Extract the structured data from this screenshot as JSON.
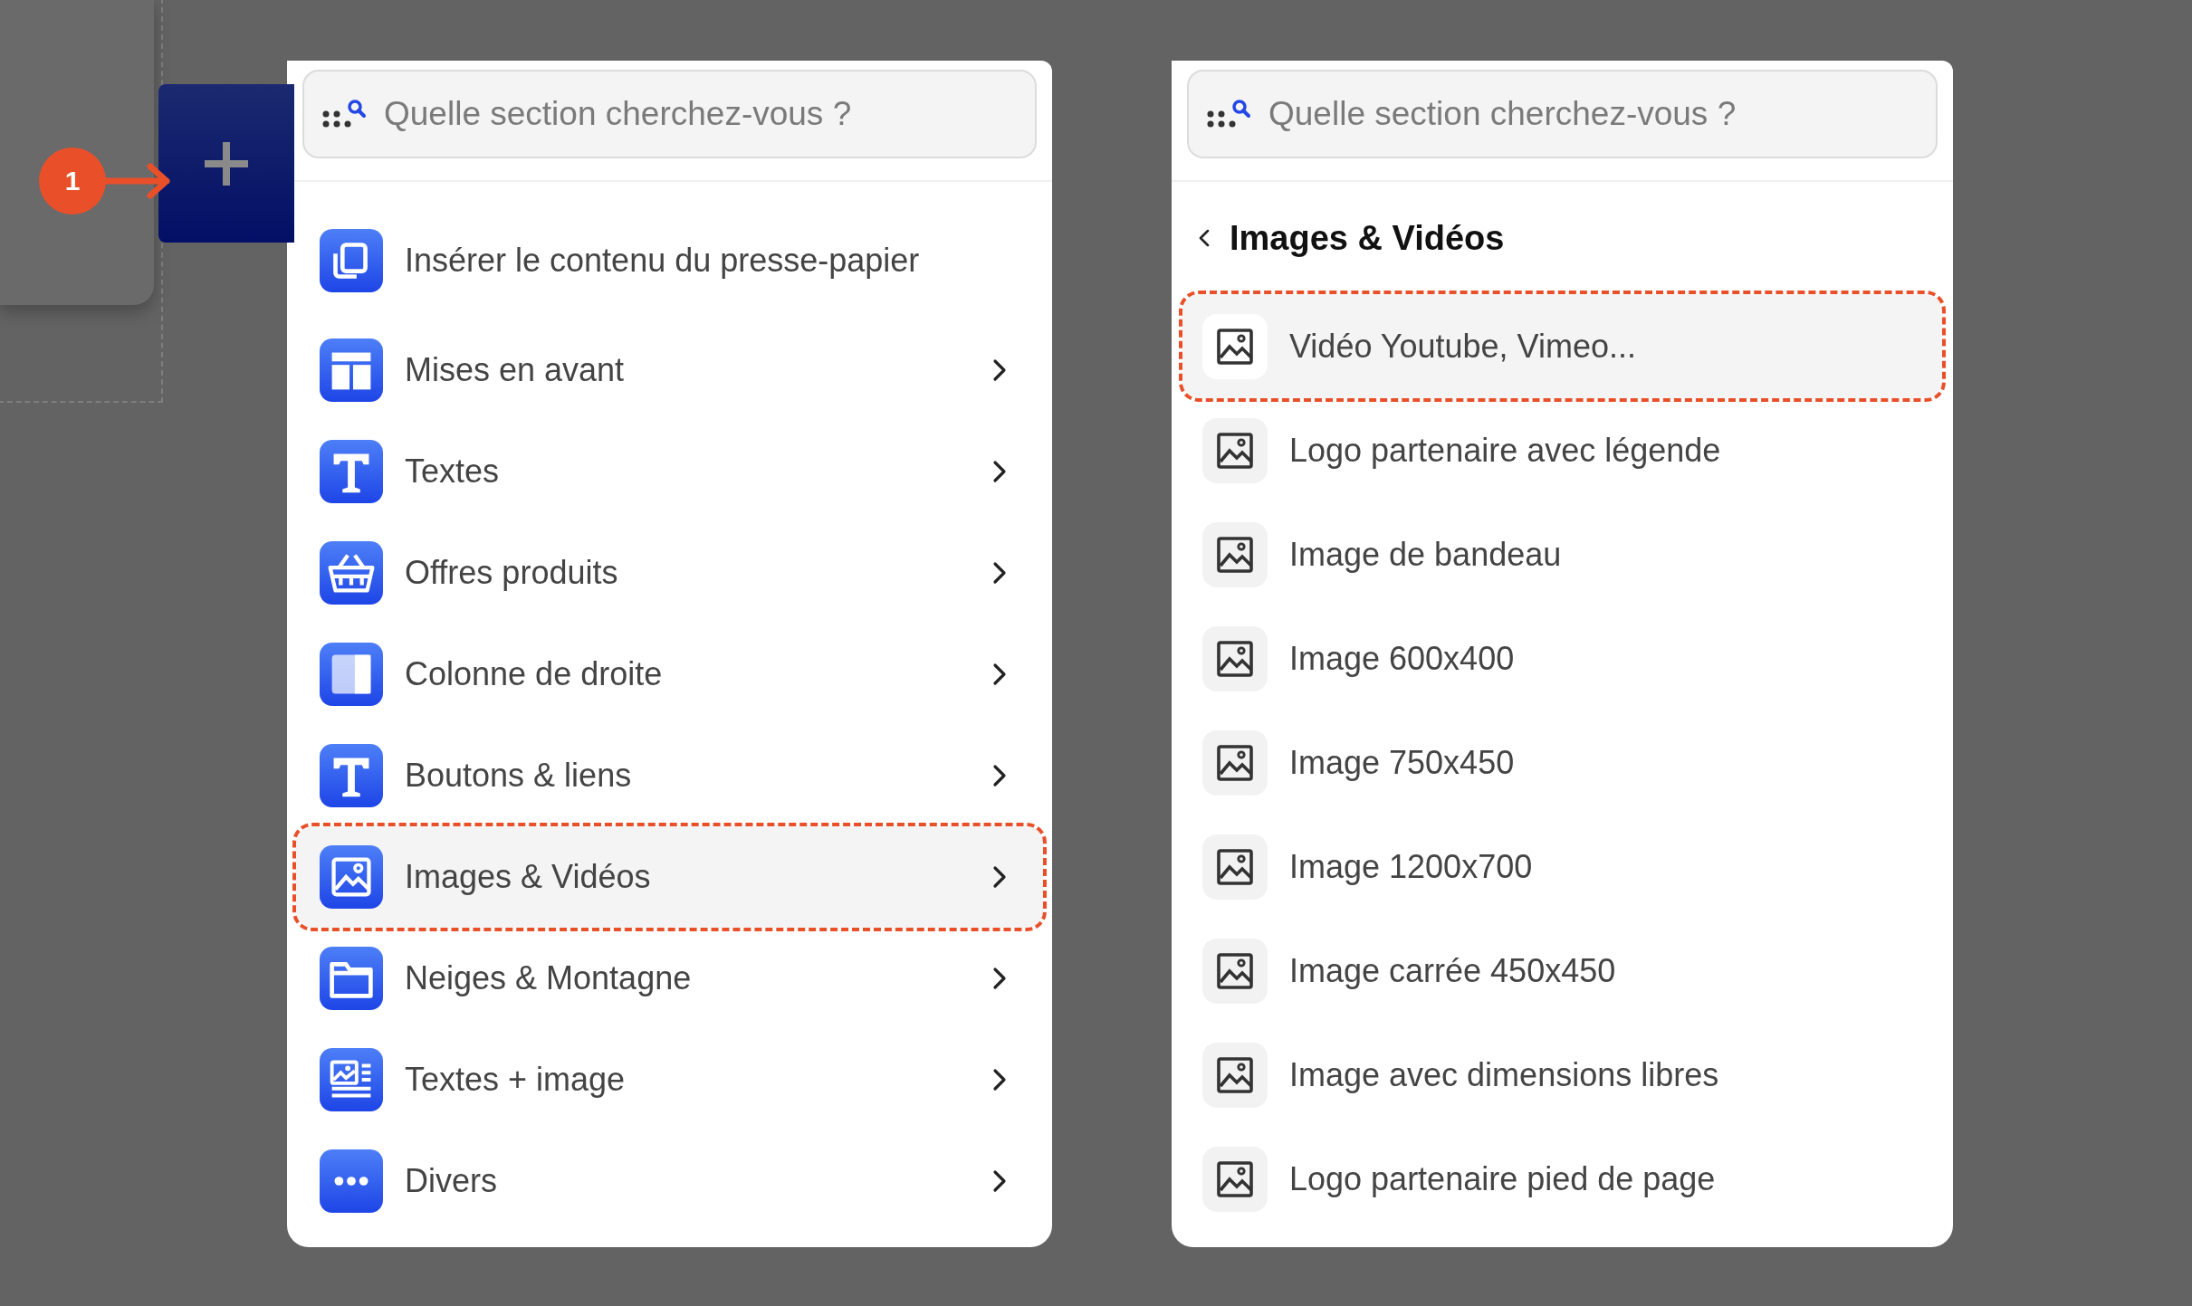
{
  "annotation": {
    "badge": "1"
  },
  "left_panel": {
    "search": {
      "placeholder": "Quelle section cherchez-vous ?"
    },
    "items": [
      {
        "label": "Insérer le contenu du presse-papier",
        "kind": "action",
        "selected": false
      },
      {
        "label": "Mises en avant",
        "kind": "submenu",
        "selected": false
      },
      {
        "label": "Textes",
        "kind": "submenu",
        "selected": false
      },
      {
        "label": "Offres produits",
        "kind": "submenu",
        "selected": false
      },
      {
        "label": "Colonne de droite",
        "kind": "submenu",
        "selected": false
      },
      {
        "label": "Boutons & liens",
        "kind": "submenu",
        "selected": false
      },
      {
        "label": "Images & Vidéos",
        "kind": "submenu",
        "selected": true
      },
      {
        "label": "Neiges & Montagne",
        "kind": "submenu",
        "selected": false
      },
      {
        "label": "Textes + image",
        "kind": "submenu",
        "selected": false
      },
      {
        "label": "Divers",
        "kind": "submenu",
        "selected": false
      }
    ]
  },
  "right_panel": {
    "search": {
      "placeholder": "Quelle section cherchez-vous ?"
    },
    "title": "Images & Vidéos",
    "items": [
      {
        "label": "Vidéo Youtube, Vimeo...",
        "selected": true
      },
      {
        "label": "Logo partenaire avec légende",
        "selected": false
      },
      {
        "label": "Image de bandeau",
        "selected": false
      },
      {
        "label": "Image 600x400",
        "selected": false
      },
      {
        "label": "Image 750x450",
        "selected": false
      },
      {
        "label": "Image 1200x700",
        "selected": false
      },
      {
        "label": "Image carrée 450x450",
        "selected": false
      },
      {
        "label": "Image avec dimensions libres",
        "selected": false
      },
      {
        "label": "Logo partenaire pied de page",
        "selected": false
      }
    ]
  }
}
